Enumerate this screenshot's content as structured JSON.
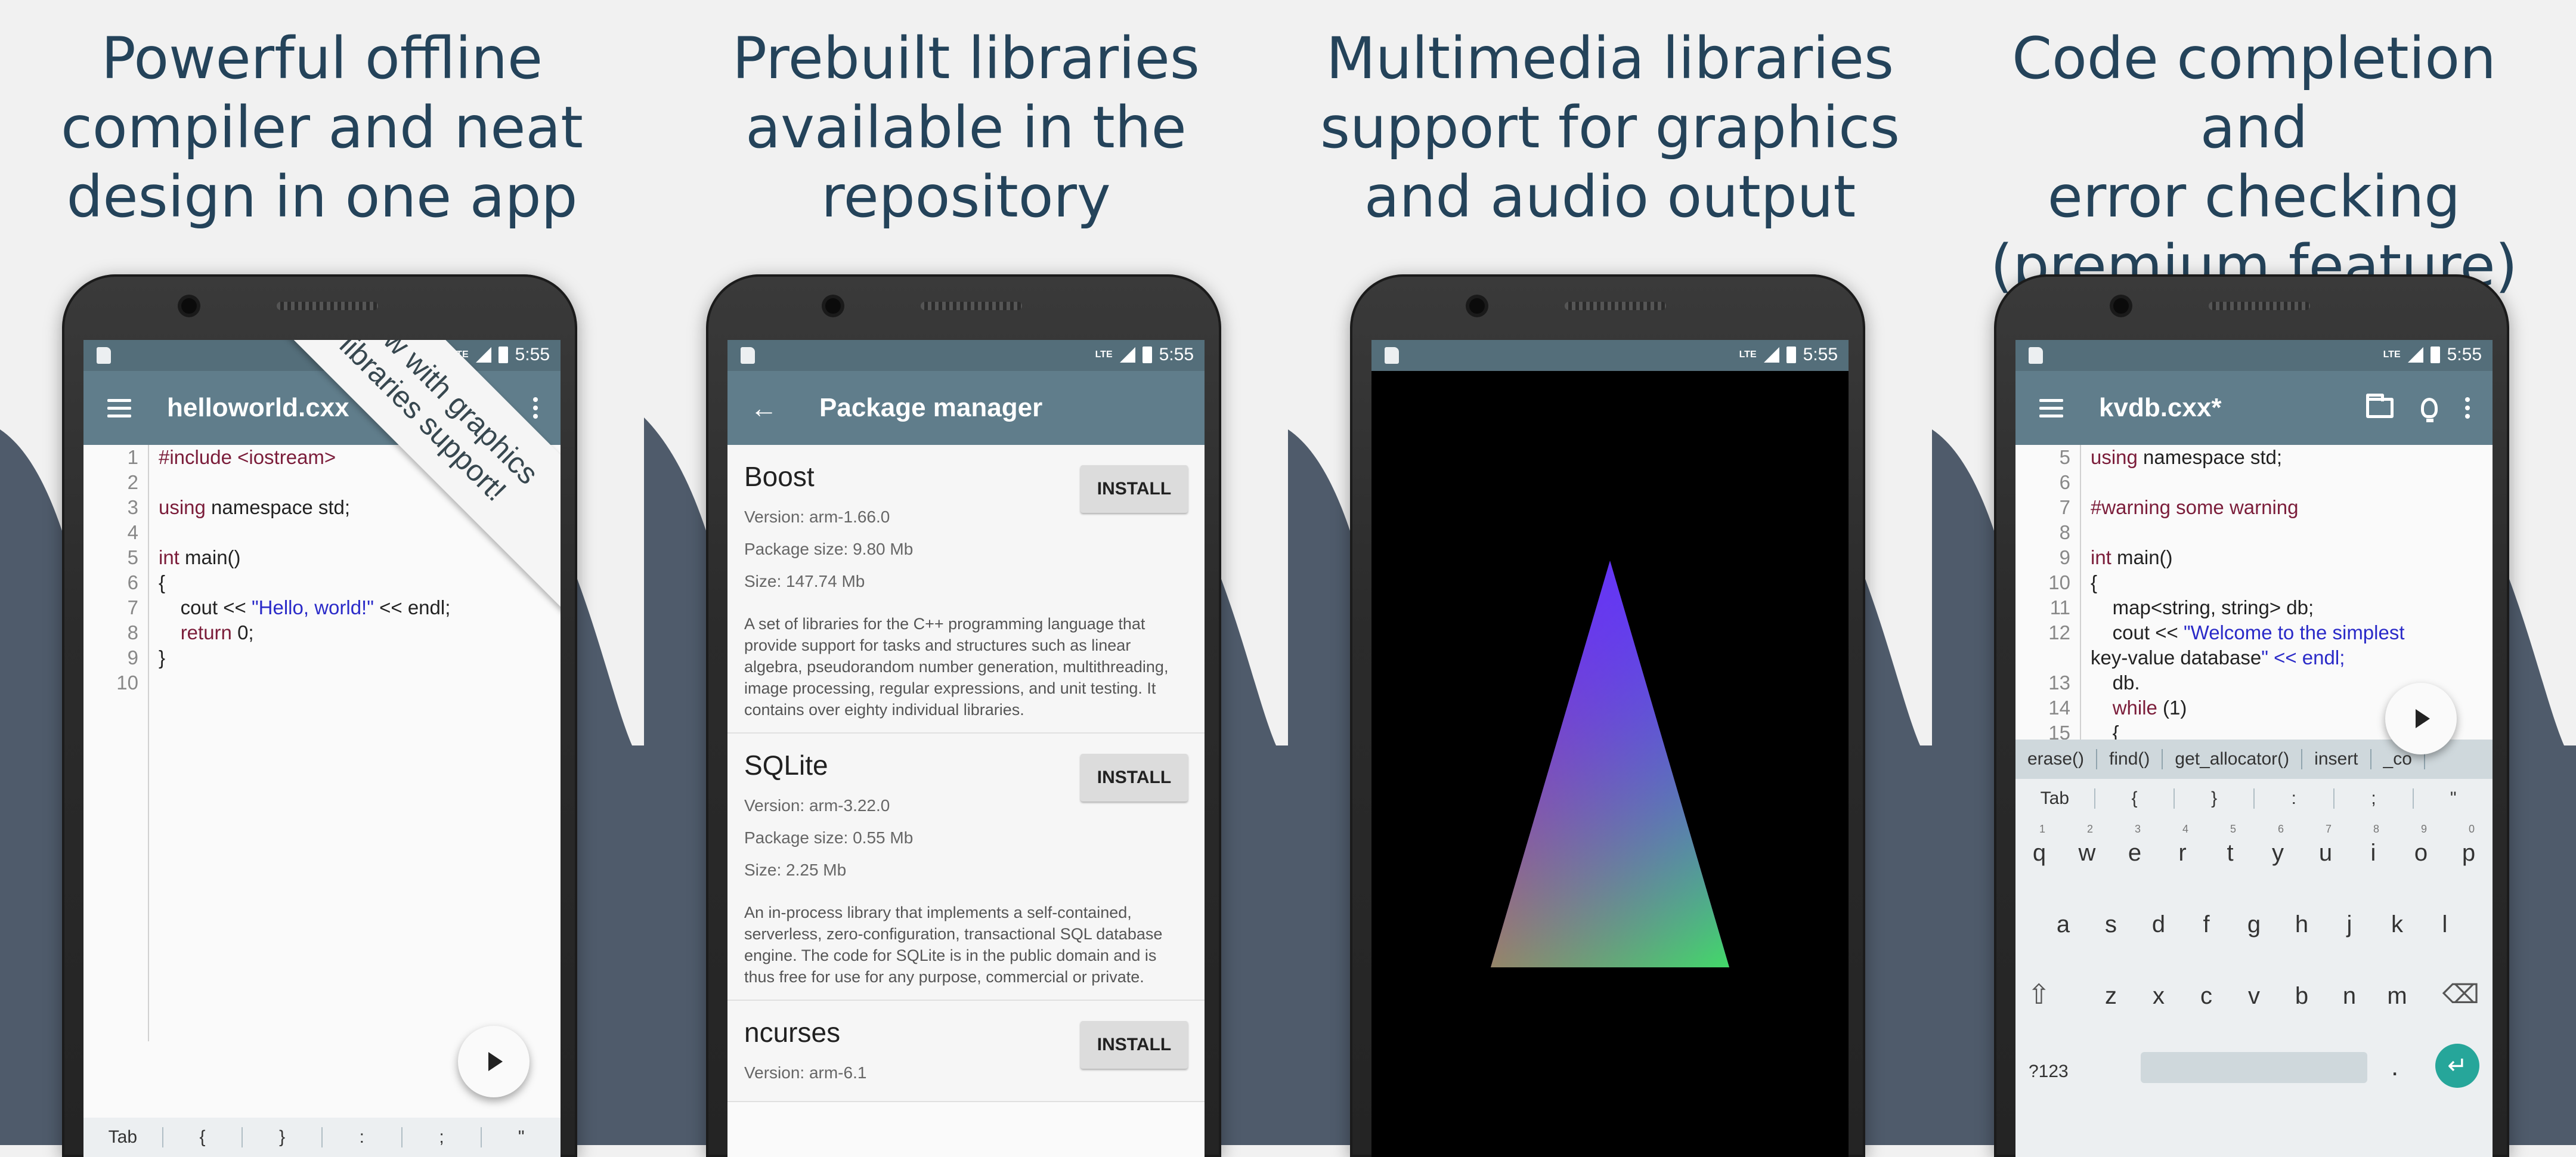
{
  "panels": [
    {
      "headline": [
        "Powerful offline",
        "compiler and neat",
        "design in one app"
      ]
    },
    {
      "headline": [
        "Prebuilt libraries",
        "available in the",
        "repository"
      ]
    },
    {
      "headline": [
        "Multimedia libraries",
        "support for graphics",
        "and audio output"
      ]
    },
    {
      "headline": [
        "Code completion and",
        "error checking",
        "(premium feature)"
      ]
    }
  ],
  "status_time": "5:55",
  "status_network": "LTE",
  "editor1": {
    "title": "helloworld.cxx",
    "ribbon": [
      "Now with graphics",
      "libraries support!"
    ],
    "line_numbers": [
      "1",
      "2",
      "3",
      "4",
      "5",
      "6",
      "7",
      "8",
      "9",
      "10"
    ],
    "lines": [
      [
        "#include <iostream>"
      ],
      [
        ""
      ],
      [
        "using namespace std;"
      ],
      [
        ""
      ],
      [
        "int main()"
      ],
      [
        "{"
      ],
      [
        "    cout << ",
        "\"Hello, world!\"",
        " << endl;"
      ],
      [
        "    return 0;"
      ],
      [
        "}"
      ],
      [
        ""
      ]
    ],
    "symbols": [
      "Tab",
      "{",
      "}",
      ":",
      ";",
      "\""
    ]
  },
  "package_manager": {
    "title": "Package manager",
    "install_label": "INSTALL",
    "packages": [
      {
        "name": "Boost",
        "version": "Version: arm-1.66.0",
        "package_size": "Package size: 9.80 Mb",
        "size": "Size: 147.74 Mb",
        "description": "A set of libraries for the C++ programming language that provide support for tasks and structures such as linear algebra, pseudorandom number generation, multithreading, image processing, regular expressions, and unit testing. It contains over eighty individual libraries."
      },
      {
        "name": "SQLite",
        "version": "Version: arm-3.22.0",
        "package_size": "Package size: 0.55 Mb",
        "size": "Size: 2.25 Mb",
        "description": "An in-process library that implements a self-contained, serverless, zero-configuration, transactional SQL database engine. The code for SQLite is in the public domain and is thus free for use for any purpose, commercial or private."
      },
      {
        "name": "ncurses",
        "version": "Version: arm-6.1"
      }
    ]
  },
  "editor4": {
    "title": "kvdb.cxx*",
    "line_numbers": [
      "5",
      "6",
      "7",
      "8",
      "9",
      "10",
      "11",
      "12",
      "",
      "13",
      "14",
      "15"
    ],
    "lines": [
      "using namespace std;",
      "",
      "#warning some warning",
      "",
      "int main()",
      "{",
      "    map<string, string> db;",
      "    cout << \"Welcome to the simplest",
      "key-value database\" << endl;",
      "    db.",
      "    while (1)",
      "    {"
    ],
    "suggestions": [
      "erase()",
      "find()",
      "get_allocator()",
      "insert",
      "_co"
    ],
    "symbols": [
      "Tab",
      "{",
      "}",
      ":",
      ";",
      "\""
    ],
    "keyboard": {
      "row1": [
        "q",
        "w",
        "e",
        "r",
        "t",
        "y",
        "u",
        "i",
        "o",
        "p"
      ],
      "row1_digits": [
        "1",
        "2",
        "3",
        "4",
        "5",
        "6",
        "7",
        "8",
        "9",
        "0"
      ],
      "row2": [
        "a",
        "s",
        "d",
        "f",
        "g",
        "h",
        "j",
        "k",
        "l"
      ],
      "row3": [
        "z",
        "x",
        "c",
        "v",
        "b",
        "n",
        "m"
      ],
      "mode_key": "?123",
      "comma": ",",
      "period": "."
    }
  },
  "colors": {
    "headline": "#24435a",
    "toolbar": "#607d8b",
    "statusbar": "#546e7a",
    "wave": "#4f5b6b",
    "keyword": "#7b1d3a",
    "string": "#2a2ac8",
    "enter_key": "#26a69a"
  }
}
